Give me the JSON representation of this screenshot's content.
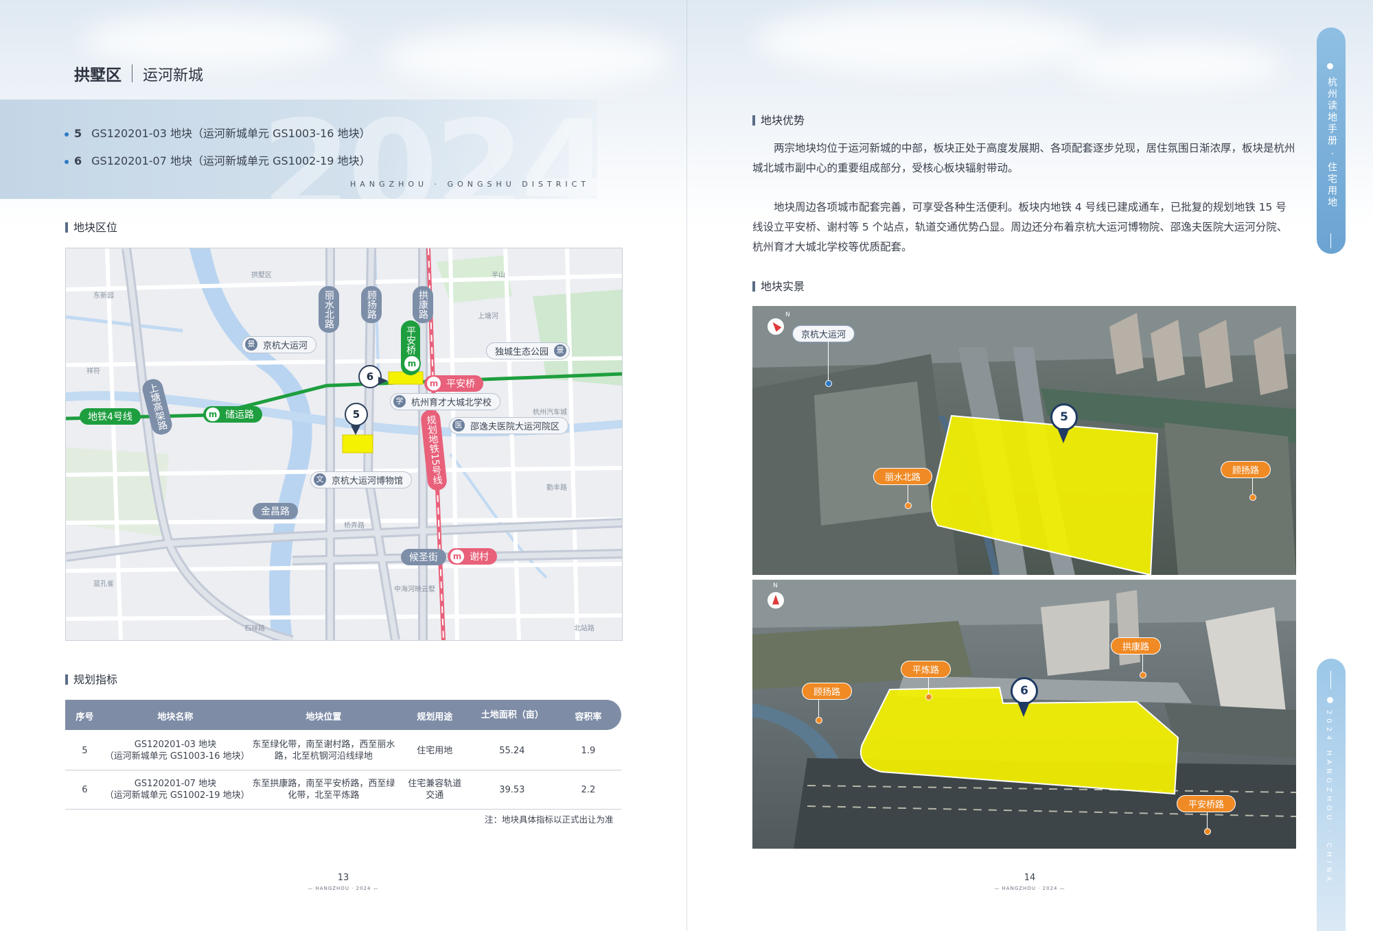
{
  "header": {
    "district": "拱墅区",
    "area": "运河新城",
    "plots": [
      {
        "num": "5",
        "text": "GS120201-03 地块（运河新城单元 GS1003-16 地块）"
      },
      {
        "num": "6",
        "text": "GS120201-07 地块（运河新城单元 GS1002-19 地块）"
      }
    ],
    "district_en": "HANGZHOU · GONGSHU DISTRICT",
    "year_watermark": "2024"
  },
  "sidebar": {
    "tab1_text": "杭州读地手册 · 住宅用地",
    "tab2_text": "2024 HANGZHOU · CHINA"
  },
  "left": {
    "location_heading": "地块区位",
    "map": {
      "roads": [
        "丽水北路",
        "顾扬路",
        "拱康路",
        "上塘高架路",
        "金昌路",
        "候圣街"
      ],
      "metro": [
        "地铁4号线",
        "储运路",
        "平安桥",
        "平安桥",
        "谢村",
        "规划地铁15号线"
      ],
      "pois": [
        "京杭大运河",
        "独城生态公园",
        "杭州育才大城北学校",
        "邵逸夫医院大运河院区",
        "京杭大运河博物馆"
      ],
      "markers": [
        "6",
        "5"
      ],
      "small_labels": [
        "拱墅区",
        "杭州汽车城",
        "东新园",
        "祥符",
        "半山",
        "北站路",
        "蓝孔雀",
        "勤丰路",
        "上塘河",
        "桥弄路",
        "石祥路",
        "中海河映云墅"
      ]
    },
    "indicators_heading": "规划指标",
    "table": {
      "headers": [
        "序号",
        "地块名称",
        "地块位置",
        "规划用途",
        "土地面积（亩）",
        "容积率"
      ],
      "rows": [
        {
          "no": "5",
          "name1": "GS120201-03 地块",
          "name2": "（运河新城单元 GS1003-16 地块）",
          "loc1": "东至绿化带，南至谢村路，西至丽水",
          "loc2": "路，北至杭钢河沿线绿地",
          "use1": "住宅用地",
          "use2": "",
          "area": "55.24",
          "far": "1.9"
        },
        {
          "no": "6",
          "name1": "GS120201-07 地块",
          "name2": "（运河新城单元 GS1002-19 地块）",
          "loc1": "东至拱康路，南至平安桥路，西至绿",
          "loc2": "化带，北至平炼路",
          "use1": "住宅兼容轨道",
          "use2": "交通",
          "area": "39.53",
          "far": "2.2"
        }
      ],
      "note": "注：地块具体指标以正式出让为准"
    },
    "page_number": "13",
    "page_footer": "— HANGZHOU · 2024 —"
  },
  "right": {
    "advantage_heading": "地块优势",
    "para1": "两宗地块均位于运河新城的中部，板块正处于高度发展期、各项配套逐步兑现，居住氛围日渐浓厚，板块是杭州城北城市副中心的重要组成部分，受核心板块辐射带动。",
    "para2": "地块周边各项城市配套完善，可享受各种生活便利。板块内地铁 4 号线已建成通车，已批复的规划地铁 15 号线设立平安桥、谢村等 5 个站点，轨道交通优势凸显。周边还分布着京杭大运河博物院、邵逸夫医院大运河分院、杭州育才大城北学校等优质配套。",
    "photos_heading": "地块实景",
    "photo1": {
      "marker": "5",
      "labels": [
        "京杭大运河",
        "丽水北路",
        "顾扬路"
      ],
      "north": "N"
    },
    "photo2": {
      "marker": "6",
      "labels": [
        "顾扬路",
        "平炼路",
        "拱康路",
        "平安桥路"
      ],
      "north": "N"
    },
    "page_number": "14",
    "page_footer": "— HANGZHOU · 2024 —"
  },
  "colors": {
    "accent": "#2f79c4",
    "table_header": "#7e8ca6",
    "plot_fill": "#f5f200",
    "metro_green": "#1e9e3e",
    "metro_pink": "#e8607a",
    "callout_orange": "#f08a24"
  }
}
